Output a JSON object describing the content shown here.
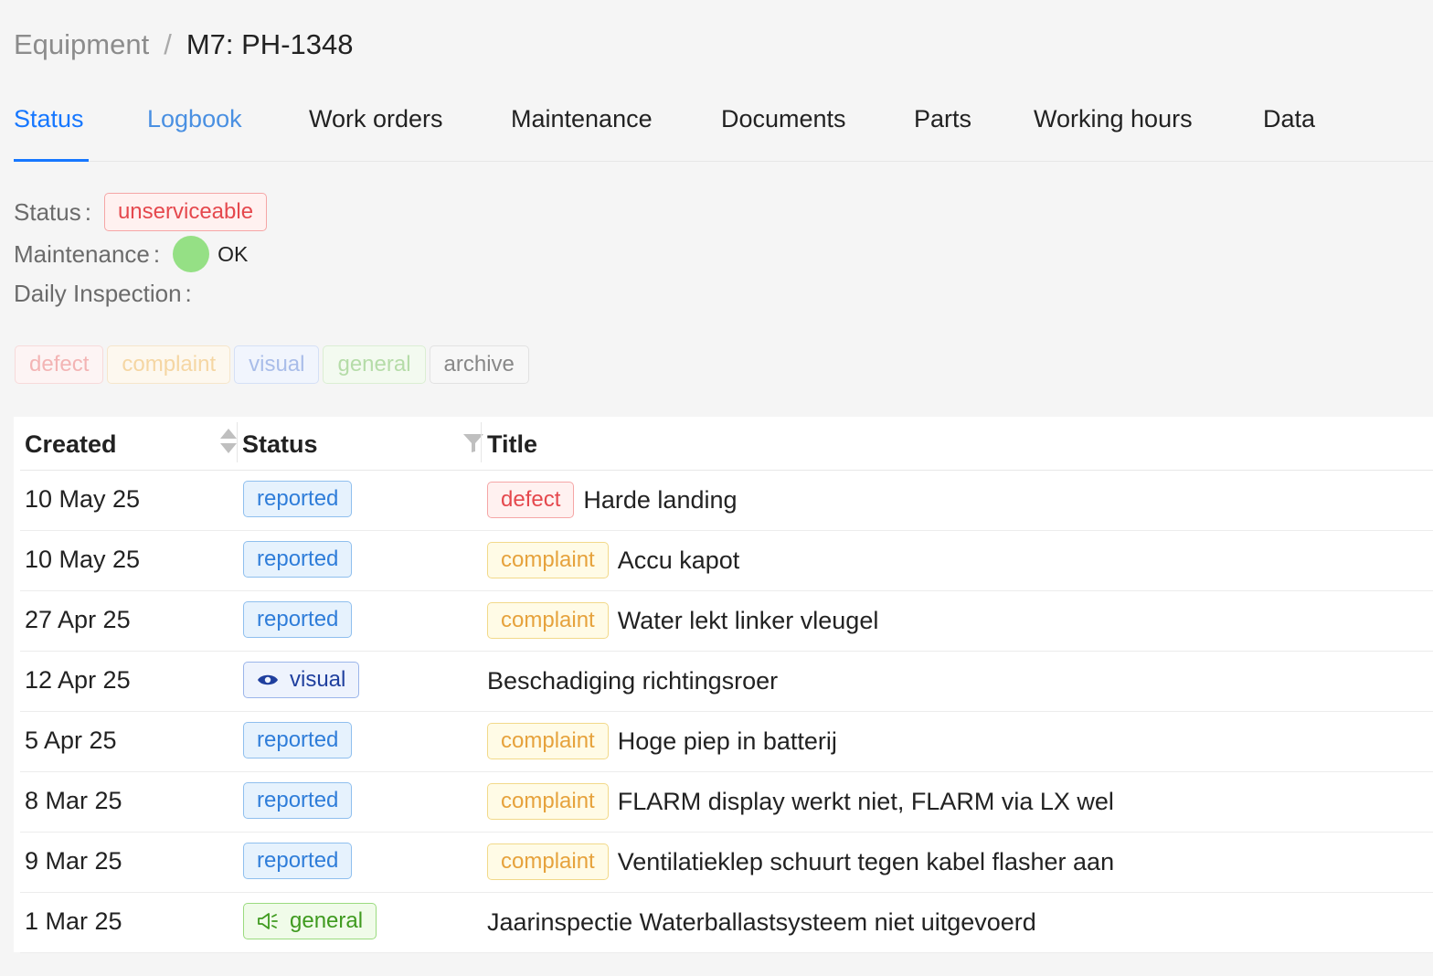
{
  "breadcrumb": {
    "parent": "Equipment",
    "separator": "/",
    "current": "M7: PH-1348"
  },
  "tabs": [
    {
      "label": "Status",
      "state": "active"
    },
    {
      "label": "Logbook",
      "state": "link"
    },
    {
      "label": "Work orders",
      "state": ""
    },
    {
      "label": "Maintenance",
      "state": ""
    },
    {
      "label": "Documents",
      "state": ""
    },
    {
      "label": "Parts",
      "state": ""
    },
    {
      "label": "Working hours",
      "state": ""
    },
    {
      "label": "Data",
      "state": ""
    }
  ],
  "info": {
    "status_label": "Status",
    "status_value": "unserviceable",
    "maintenance_label": "Maintenance",
    "maintenance_value": "OK",
    "maintenance_color": "#95e085",
    "daily_inspection_label": "Daily Inspection",
    "colon": ":"
  },
  "filters": [
    "defect",
    "complaint",
    "visual",
    "general",
    "archive"
  ],
  "table": {
    "columns": {
      "created": "Created",
      "status": "Status",
      "title": "Title"
    },
    "rows": [
      {
        "created": "10 May 25",
        "status": "reported",
        "status_icon": "",
        "tag": "defect",
        "title": "Harde landing"
      },
      {
        "created": "10 May 25",
        "status": "reported",
        "status_icon": "",
        "tag": "complaint",
        "title": "Accu kapot"
      },
      {
        "created": "27 Apr 25",
        "status": "reported",
        "status_icon": "",
        "tag": "complaint",
        "title": "Water lekt linker vleugel"
      },
      {
        "created": "12 Apr 25",
        "status": "visual",
        "status_icon": "eye-icon",
        "tag": "",
        "title": "Beschadiging richtingsroer"
      },
      {
        "created": "5 Apr 25",
        "status": "reported",
        "status_icon": "",
        "tag": "complaint",
        "title": "Hoge piep in batterij"
      },
      {
        "created": "8 Mar 25",
        "status": "reported",
        "status_icon": "",
        "tag": "complaint",
        "title": "FLARM display werkt niet, FLARM via LX wel"
      },
      {
        "created": "9 Mar 25",
        "status": "reported",
        "status_icon": "",
        "tag": "complaint",
        "title": "Ventilatieklep schuurt tegen kabel flasher aan"
      },
      {
        "created": "1 Mar 25",
        "status": "general",
        "status_icon": "megaphone-icon",
        "tag": "",
        "title": "Jaarinspectie Waterballastsysteem niet uitgevoerd"
      }
    ]
  },
  "colors": {
    "accent": "#1677ff",
    "defect": "#e5484d",
    "complaint": "#e6a23c",
    "reported": "#2f7dd9",
    "visual": "#1f3f9e",
    "general": "#3f9a1f"
  }
}
